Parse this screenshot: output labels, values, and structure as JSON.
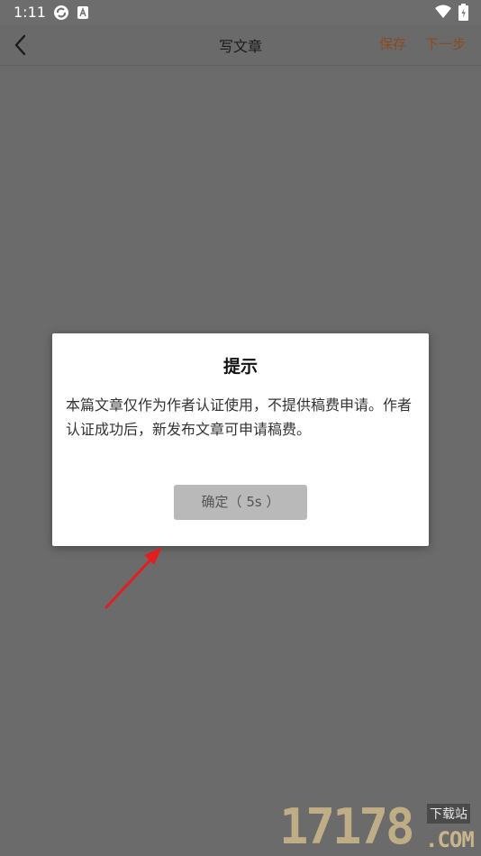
{
  "status_bar": {
    "time": "1:11",
    "icons": [
      "sync-icon",
      "app-a-icon",
      "wifi-icon",
      "battery-icon"
    ]
  },
  "header": {
    "back_icon": "chevron-left-icon",
    "title": "写文章",
    "save_label": "保存",
    "next_label": "下一步"
  },
  "dialog": {
    "title": "提示",
    "message": "本篇文章仅作为作者认证使用，不提供稿费申请。作者认证成功后，新发布文章可申请稿费。",
    "confirm_label": "确定（ 5s ）"
  },
  "watermark": {
    "number": "17178",
    "label": "下载站",
    "domain": ".COM"
  },
  "colors": {
    "overlay_background": "#6b6b6b",
    "accent": "#8c4a20",
    "dialog_background": "#ffffff",
    "button_background": "#b9b9b9",
    "annotation_arrow": "#e02020"
  }
}
